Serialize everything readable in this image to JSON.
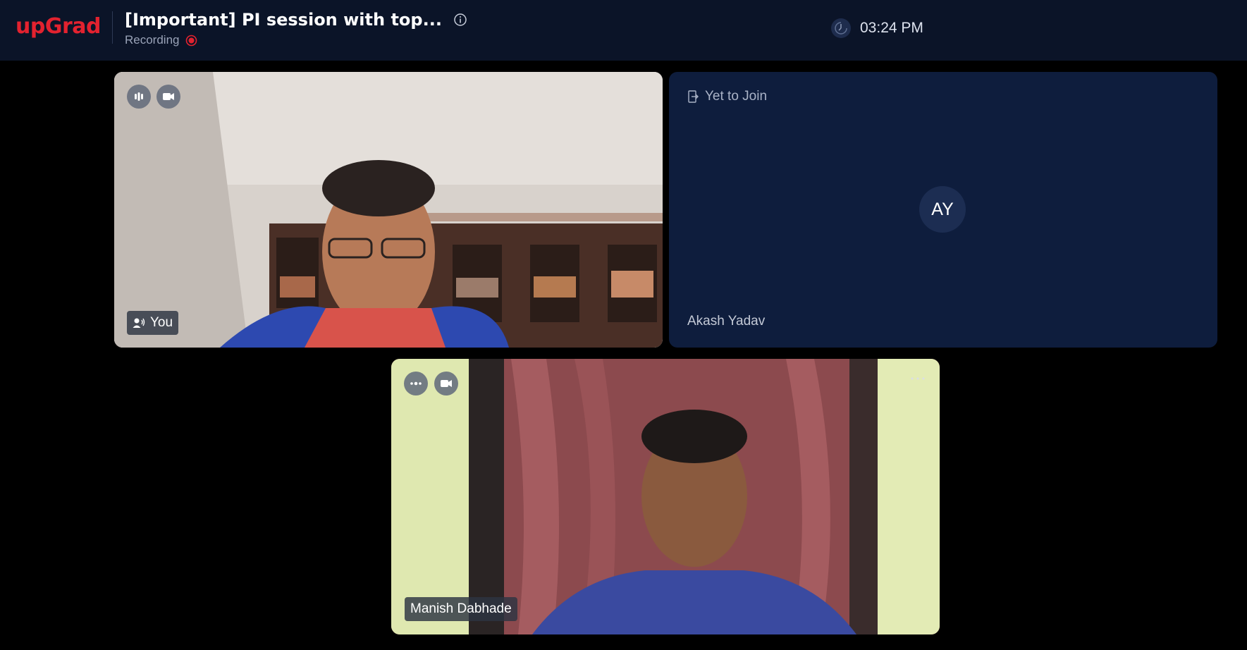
{
  "header": {
    "logo": "upGrad",
    "session_title": "[Important] PI session with top...",
    "recording_label": "Recording",
    "time": "03:24 PM"
  },
  "tiles": [
    {
      "participant": "You",
      "status": "video",
      "controls": [
        "audio-level-icon",
        "camera-icon"
      ]
    },
    {
      "participant": "Akash Yadav",
      "status_label": "Yet to Join",
      "avatar_initials": "AY"
    },
    {
      "participant": "Manish Dabhade",
      "status": "video",
      "controls": [
        "audio-idle-icon",
        "camera-icon"
      ]
    }
  ],
  "colors": {
    "header_bg": "#0b1428",
    "brand": "#e3222f",
    "tile_bg": "#0e1d3d",
    "avatar_bg": "#1c2d52",
    "recording": "#e3222f"
  }
}
